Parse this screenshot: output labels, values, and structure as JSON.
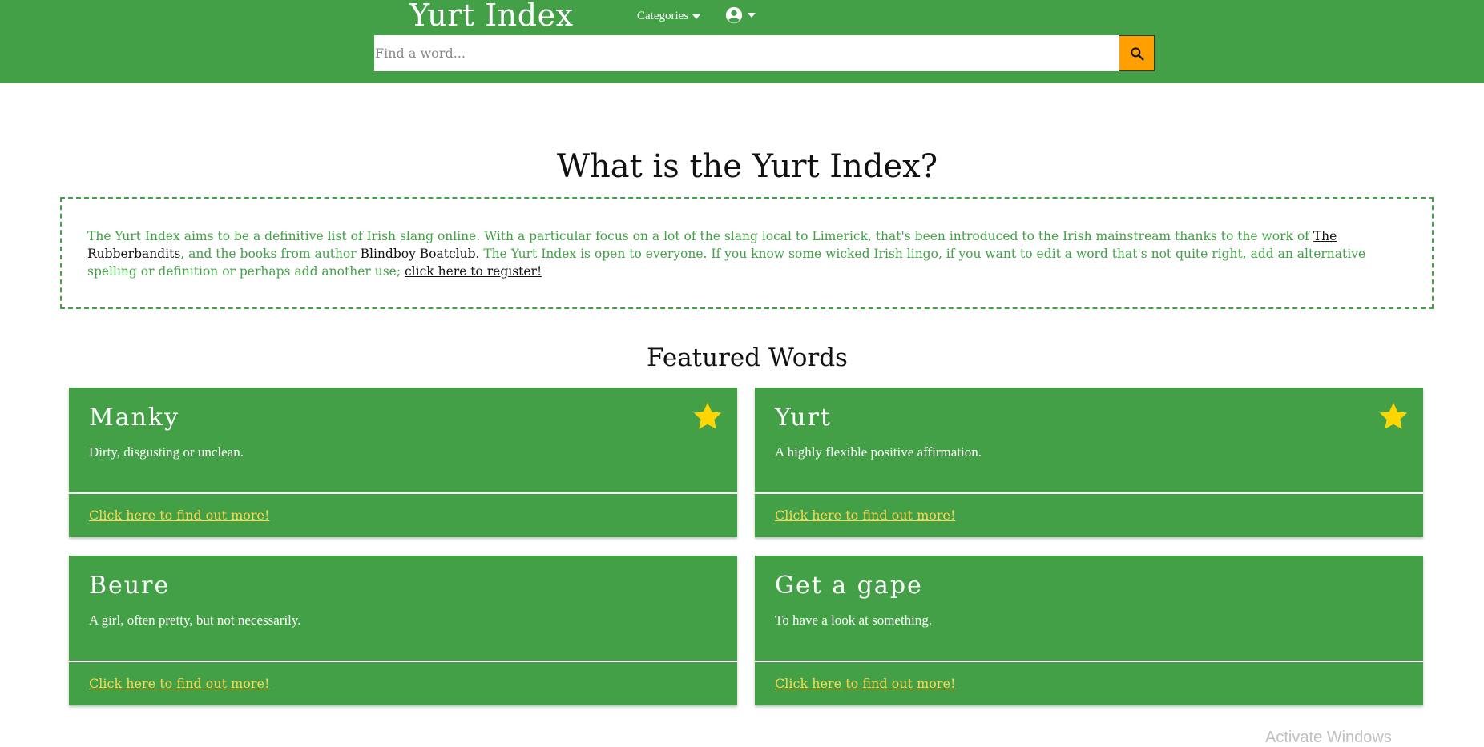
{
  "header": {
    "brand": "Yurt Index",
    "categories_label": "Categories",
    "search": {
      "placeholder": "Find a word..."
    },
    "colors": {
      "bar": "#43a047",
      "search_button": "#ffa000"
    }
  },
  "intro": {
    "title": "What is the Yurt Index?",
    "text_1": "The Yurt Index aims to be a definitive list of Irish slang online. With a particular focus on a lot of the slang local to Limerick, that's been introduced to the Irish mainstream thanks to the work of ",
    "link_1": "The Rubberbandits",
    "text_2": ", and the books from author ",
    "link_2": "Blindboy Boatclub.",
    "text_3": " The Yurt Index is open to everyone. If you know some wicked Irish lingo, if you want to edit a word that's not quite right, add an alternative spelling or definition or perhaps add another use; ",
    "link_3": "click here to register!"
  },
  "featured": {
    "title": "Featured Words",
    "cards": [
      {
        "word": "Manky",
        "definition": "Dirty, disgusting or unclean.",
        "link": "Click here to find out more!",
        "starred": true
      },
      {
        "word": "Yurt",
        "definition": "A highly flexible positive affirmation.",
        "link": "Click here to find out more!",
        "starred": true
      },
      {
        "word": "Beure",
        "definition": "A girl, often pretty, but not necessarily.",
        "link": "Click here to find out more!",
        "starred": false
      },
      {
        "word": "Get a gape",
        "definition": "To have a look at something.",
        "link": "Click here to find out more!",
        "starred": false
      }
    ]
  },
  "os_overlay": {
    "watermark": "Activate Windows"
  }
}
